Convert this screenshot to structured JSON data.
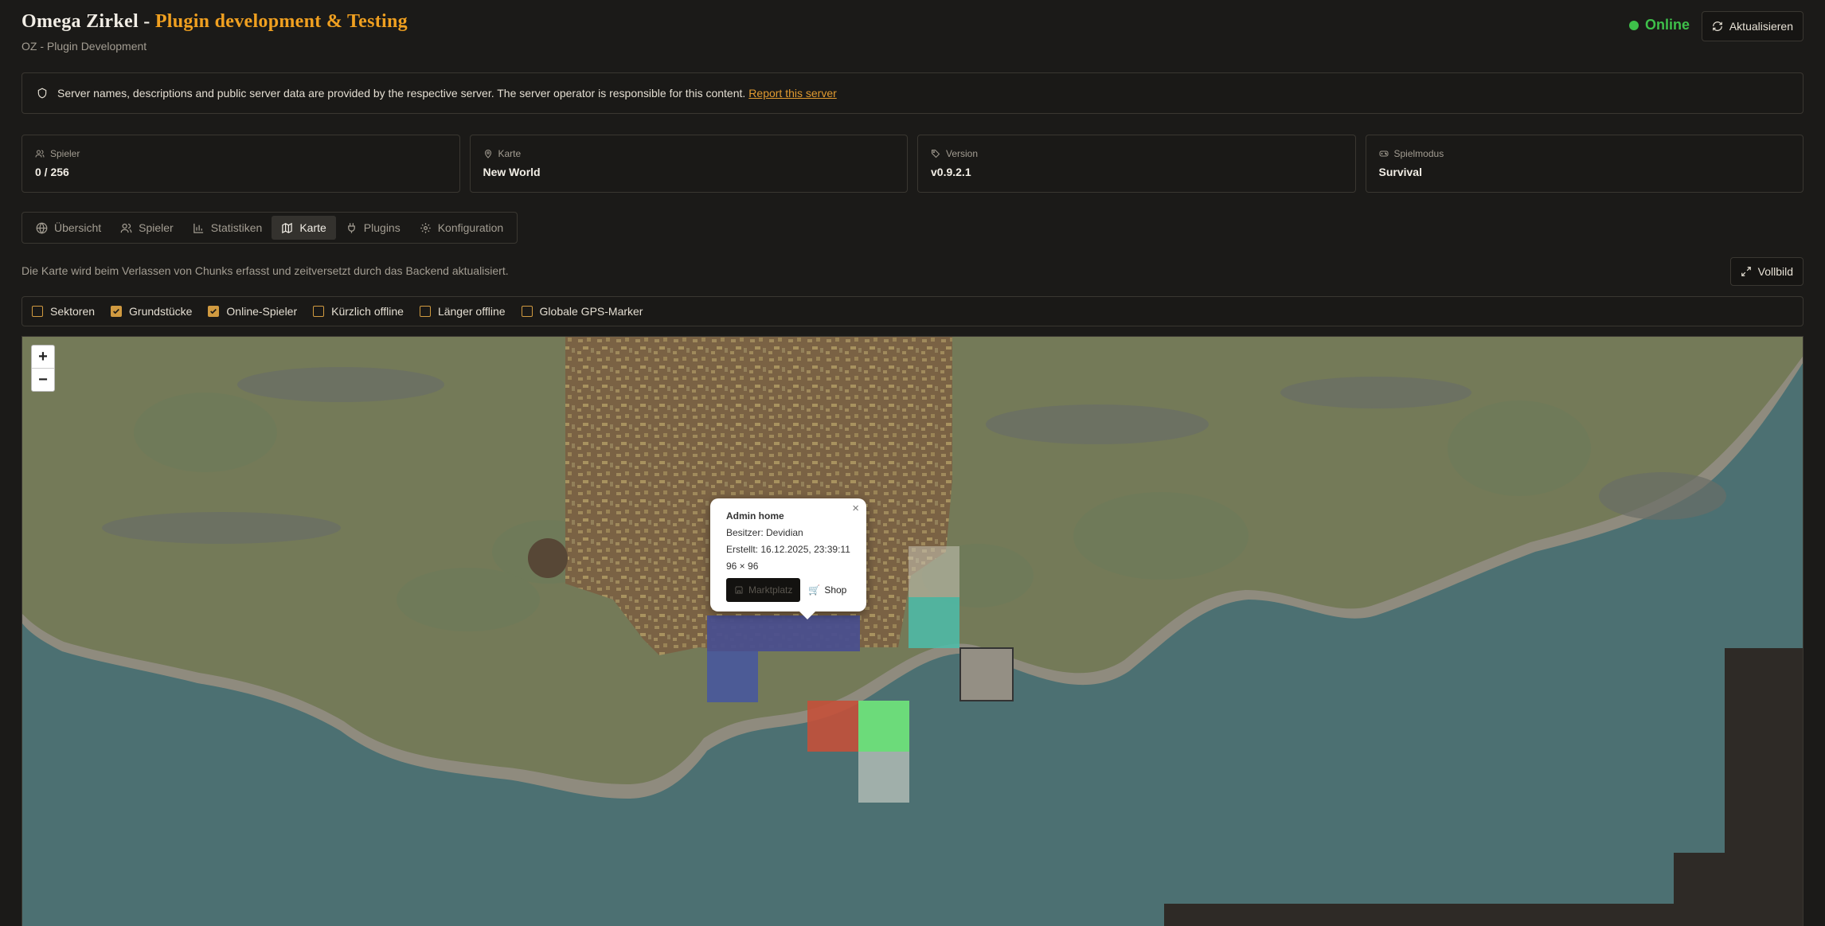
{
  "header": {
    "title_main": "Omega Zirkel - ",
    "title_accent": "Plugin development & Testing",
    "subtitle": "OZ - Plugin Development",
    "status": "Online",
    "refresh_label": "Aktualisieren"
  },
  "notice": {
    "text": "Server names, descriptions and public server data are provided by the respective server. The server operator is responsible for this content.",
    "link": "Report this server"
  },
  "cards": [
    {
      "label": "Spieler",
      "value": "0 / 256",
      "icon": "users-icon"
    },
    {
      "label": "Karte",
      "value": "New World",
      "icon": "map-pin-icon"
    },
    {
      "label": "Version",
      "value": "v0.9.2.1",
      "icon": "tag-icon"
    },
    {
      "label": "Spielmodus",
      "value": "Survival",
      "icon": "gamepad-icon"
    }
  ],
  "tabs": [
    {
      "label": "Übersicht",
      "icon": "globe-icon",
      "active": false
    },
    {
      "label": "Spieler",
      "icon": "users-icon",
      "active": false
    },
    {
      "label": "Statistiken",
      "icon": "bar-chart-icon",
      "active": false
    },
    {
      "label": "Karte",
      "icon": "map-icon",
      "active": true
    },
    {
      "label": "Plugins",
      "icon": "plug-icon",
      "active": false
    },
    {
      "label": "Konfiguration",
      "icon": "gear-icon",
      "active": false
    }
  ],
  "map_hint": "Die Karte wird beim Verlassen von Chunks erfasst und zeitversetzt durch das Backend aktualisiert.",
  "fullscreen_label": "Vollbild",
  "filters": [
    {
      "label": "Sektoren",
      "checked": false
    },
    {
      "label": "Grundstücke",
      "checked": true
    },
    {
      "label": "Online-Spieler",
      "checked": true
    },
    {
      "label": "Kürzlich offline",
      "checked": false
    },
    {
      "label": "Länger offline",
      "checked": false
    },
    {
      "label": "Globale GPS-Marker",
      "checked": false
    }
  ],
  "zoom": {
    "plus": "+",
    "minus": "−"
  },
  "popup": {
    "title": "Admin home",
    "owner": "Besitzer: Devidian",
    "created": "Erstellt: 16.12.2025, 23:39:11",
    "size": "96 × 96",
    "market_label": "Marktplatz",
    "shop_label": "Shop",
    "close": "×"
  },
  "colors": {
    "accent": "#f0a020",
    "online": "#3ec04a",
    "link": "#e09a30",
    "water": "#4c7072",
    "land": "#747a58"
  }
}
